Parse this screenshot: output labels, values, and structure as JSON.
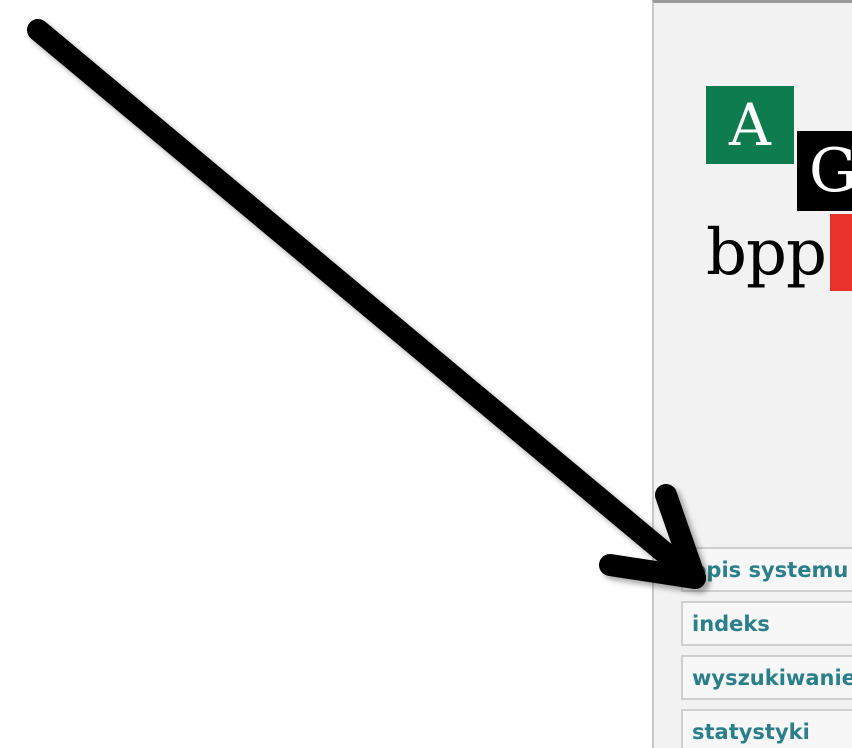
{
  "logo": {
    "letter_a": "A",
    "letter_g": "G",
    "word": "bpp",
    "colors": {
      "green": "#0e7c4f",
      "black": "#000000",
      "red": "#e8322b"
    }
  },
  "menu": {
    "items": [
      {
        "label": "opis systemu"
      },
      {
        "label": "indeks"
      },
      {
        "label": "wyszukiwanie"
      },
      {
        "label": "statystyki"
      }
    ],
    "link_color": "#2a7f8a"
  },
  "annotation": {
    "icon": "arrow-icon",
    "color": "#000000"
  }
}
